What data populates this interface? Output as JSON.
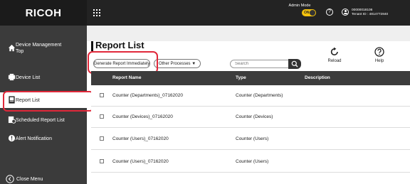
{
  "header": {
    "logo": "RICOH",
    "admin_mode_label": "Admin Mode",
    "admin_mode_toggle": "ON",
    "user_id": "00000018106",
    "tenant": "Tenant ID : 4814772840"
  },
  "sidebar": {
    "items": [
      {
        "label_line1": "Device Management",
        "label_line2": "Top",
        "icon": "home-icon"
      },
      {
        "label": "Device List",
        "icon": "device-icon"
      },
      {
        "label": "Report List",
        "icon": "report-icon"
      },
      {
        "label": "Scheduled Report List",
        "icon": "scheduled-report-icon"
      },
      {
        "label": "Alert Notification",
        "icon": "alert-icon"
      }
    ],
    "close_menu": "Close Menu"
  },
  "page": {
    "title": "Report List",
    "generate_button": "Generate Report Immediately",
    "other_processes": "Other Processes ▼",
    "search_placeholder": "Search",
    "reload_label": "Reload",
    "help_label": "Help"
  },
  "table": {
    "headers": [
      "Report Name",
      "Type",
      "Description"
    ],
    "rows": [
      {
        "name": "Counter (Departments)_07162020",
        "type": "Counter (Departments)"
      },
      {
        "name": "Counter (Devices)_07162020",
        "type": "Counter (Devices)"
      },
      {
        "name": "Counter (Users)_07162020",
        "type": "Counter (Users)"
      },
      {
        "name": "Counter (Users)_07162020",
        "type": "Counter (Users)"
      }
    ]
  },
  "colors": {
    "accent_yellow": "#f4c20d",
    "highlight_red": "#e0283a",
    "sidebar_bg": "#3b3b3b",
    "topbar_bg": "#232323"
  }
}
